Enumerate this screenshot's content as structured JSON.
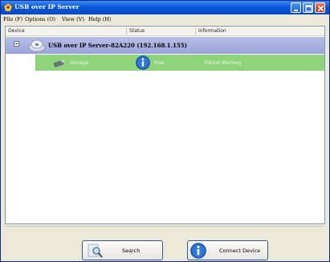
{
  "window": {
    "title": "USB over IP Server"
  },
  "menu": {
    "items": [
      "File (F)",
      "Options (O)",
      "View (V)",
      "Help (H)"
    ]
  },
  "table": {
    "columns": [
      "Device",
      "Status",
      "Information"
    ],
    "server": {
      "label": "USB over IP Server-82A220  (192.168.1.155)"
    },
    "devices": [
      {
        "name": "Storage",
        "status": "Free",
        "information": "Patriot Memory"
      }
    ]
  },
  "buttons": {
    "search_label": "Search",
    "connect_label": "Connect Device"
  },
  "icons": {
    "app": "usb-server-icon",
    "server": "server-icon",
    "device": "usb-storage-icon",
    "status": "info-icon",
    "search": "search-icon",
    "connect": "info-icon"
  },
  "colors": {
    "titlebar": "#0a58d8",
    "server_row": "#9aa4db",
    "device_row": "#8fd47b"
  }
}
